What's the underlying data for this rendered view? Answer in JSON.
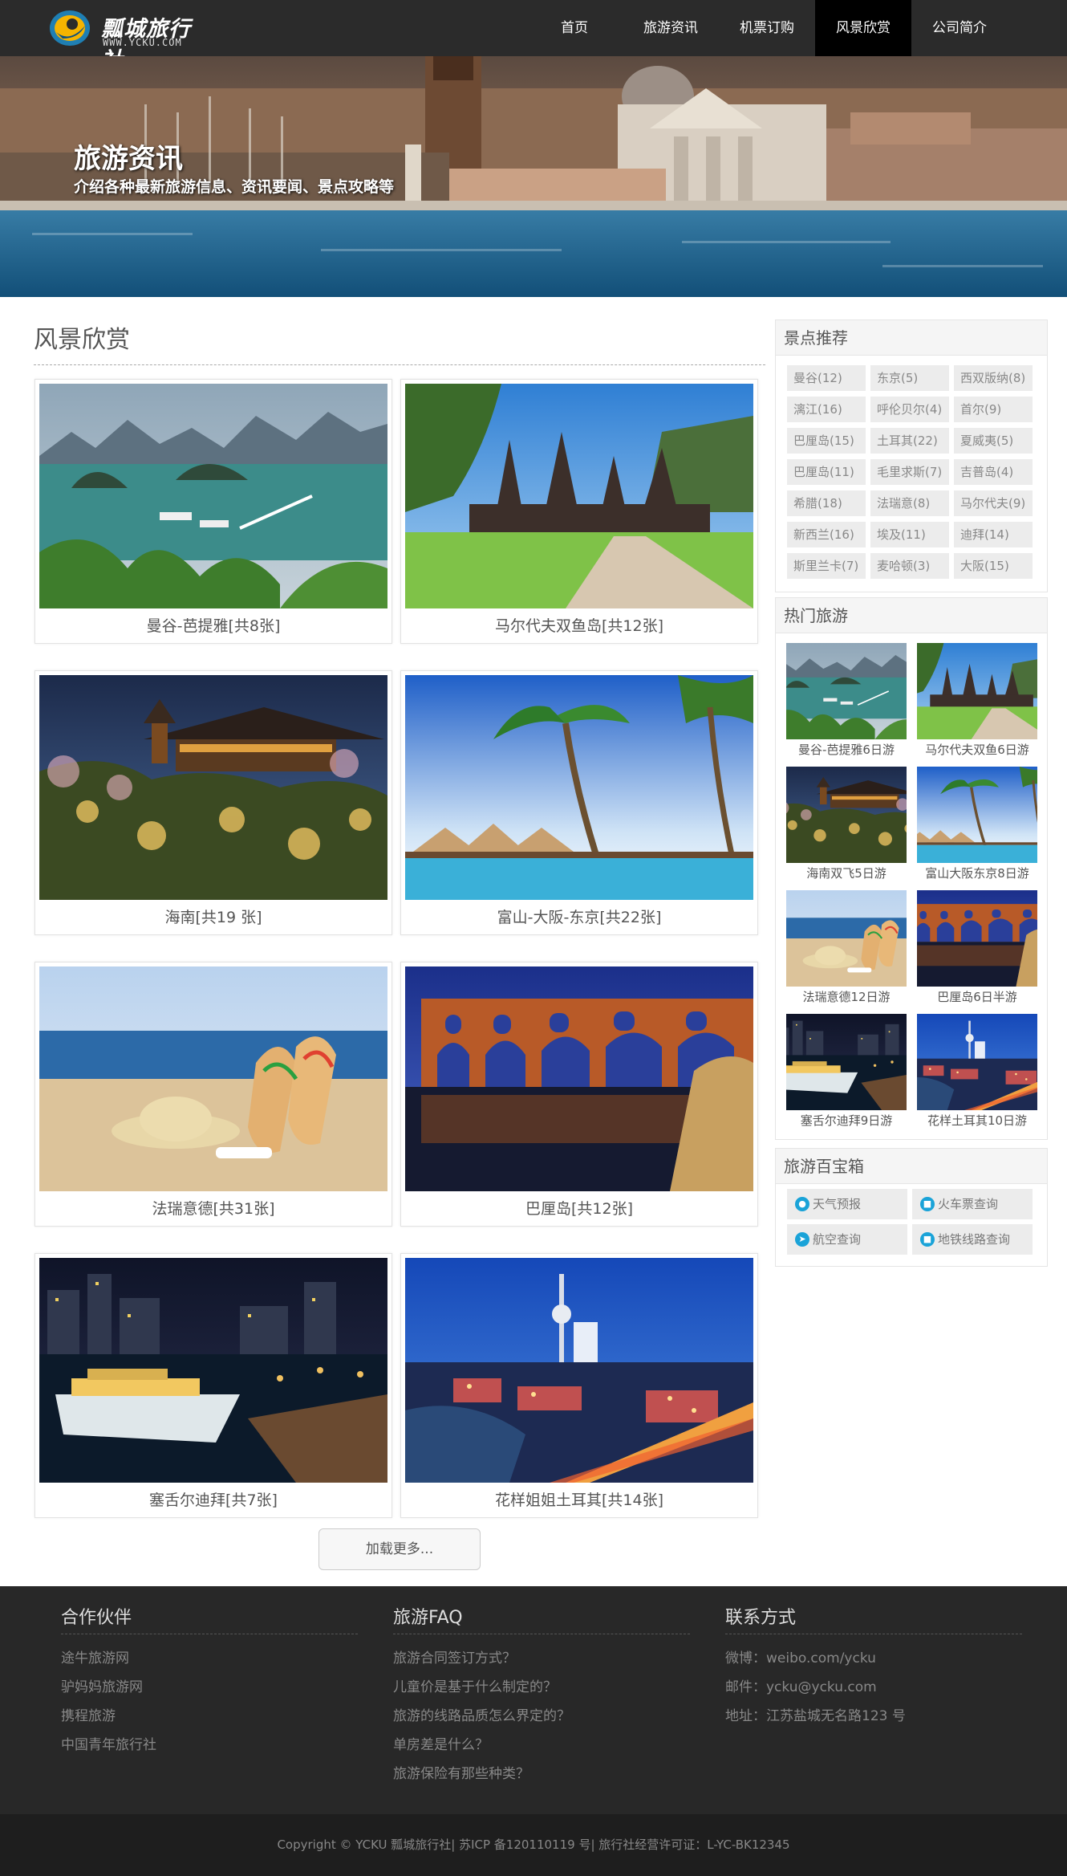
{
  "header": {
    "logo_name": "瓢城旅行社",
    "logo_url": "WWW.YCKU.COM",
    "nav": [
      {
        "label": "首页",
        "active": false
      },
      {
        "label": "旅游资讯",
        "active": false
      },
      {
        "label": "机票订购",
        "active": false
      },
      {
        "label": "风景欣赏",
        "active": true
      },
      {
        "label": "公司简介",
        "active": false
      }
    ]
  },
  "banner": {
    "title": "旅游资讯",
    "subtitle": "介绍各种最新旅游信息、资讯要闻、景点攻略等"
  },
  "main": {
    "title": "风景欣赏",
    "cards": [
      {
        "caption": "曼谷-芭提雅[共8张]",
        "image": "halong-bay"
      },
      {
        "caption": "马尔代夫双鱼岛[共12张]",
        "image": "bali-temple"
      },
      {
        "caption": "海南[共19 张]",
        "image": "kyoto-temple-night"
      },
      {
        "caption": "富山-大阪-东京[共22张]",
        "image": "palm-beach-huts"
      },
      {
        "caption": "法瑞意德[共31张]",
        "image": "beach-hat-sandals"
      },
      {
        "caption": "巴厘岛[共12张]",
        "image": "aqueduct-night"
      },
      {
        "caption": "塞舌尔迪拜[共7张]",
        "image": "harbor-night"
      },
      {
        "caption": "花样姐姐土耳其[共14张]",
        "image": "city-tower-night"
      }
    ],
    "load_more": "加载更多..."
  },
  "sidebar": {
    "scenic": {
      "title": "景点推荐",
      "tags": [
        "曼谷(12)",
        "东京(5)",
        "西双版纳(8)",
        "漓江(16)",
        "呼伦贝尔(4)",
        "首尔(9)",
        "巴厘岛(15)",
        "土耳其(22)",
        "夏威夷(5)",
        "巴厘岛(11)",
        "毛里求斯(7)",
        "吉普岛(4)",
        "希腊(18)",
        "法瑞意(8)",
        "马尔代夫(9)",
        "新西兰(16)",
        "埃及(11)",
        "迪拜(14)",
        "斯里兰卡(7)",
        "麦哈顿(3)",
        "大阪(15)"
      ]
    },
    "hot": {
      "title": "热门旅游",
      "items": [
        {
          "caption": "曼谷-芭提雅6日游",
          "image": "halong-bay"
        },
        {
          "caption": "马尔代夫双鱼6日游",
          "image": "bali-temple"
        },
        {
          "caption": "海南双飞5日游",
          "image": "kyoto-temple-night"
        },
        {
          "caption": "富山大阪东京8日游",
          "image": "palm-beach-huts"
        },
        {
          "caption": "法瑞意德12日游",
          "image": "beach-hat-sandals"
        },
        {
          "caption": "巴厘岛6日半游",
          "image": "aqueduct-night"
        },
        {
          "caption": "塞舌尔迪拜9日游",
          "image": "harbor-night"
        },
        {
          "caption": "花样土耳其10日游",
          "image": "city-tower-night"
        }
      ]
    },
    "tools": {
      "title": "旅游百宝箱",
      "items": [
        {
          "label": "天气预报",
          "icon": "location-pin-icon"
        },
        {
          "label": "火车票查询",
          "icon": "train-icon"
        },
        {
          "label": "航空查询",
          "icon": "plane-icon"
        },
        {
          "label": "地铁线路查询",
          "icon": "subway-icon"
        }
      ]
    }
  },
  "footer": {
    "columns": [
      {
        "title": "合作伙伴",
        "links": [
          "途牛旅游网",
          "驴妈妈旅游网",
          "携程旅游",
          "中国青年旅行社"
        ]
      },
      {
        "title": "旅游FAQ",
        "links": [
          "旅游合同签订方式？",
          "儿童价是基于什么制定的？",
          "旅游的线路品质怎么界定的？",
          "单房差是什么？",
          "旅游保险有那些种类？"
        ]
      },
      {
        "title": "联系方式",
        "links": [
          "微博：weibo.com/ycku",
          "邮件：ycku@ycku.com",
          "地址：江苏盐城无名路123 号"
        ]
      }
    ],
    "copyright": "Copyright © YCKU 瓢城旅行社| 苏ICP 备120110119 号| 旅行社经营许可证：L-YC-BK12345"
  },
  "colors": {
    "header_bg": "#2b2b2b",
    "nav_active_bg": "#000000",
    "footer_bg": "#282828",
    "icon_accent": "#1aa3d8"
  }
}
